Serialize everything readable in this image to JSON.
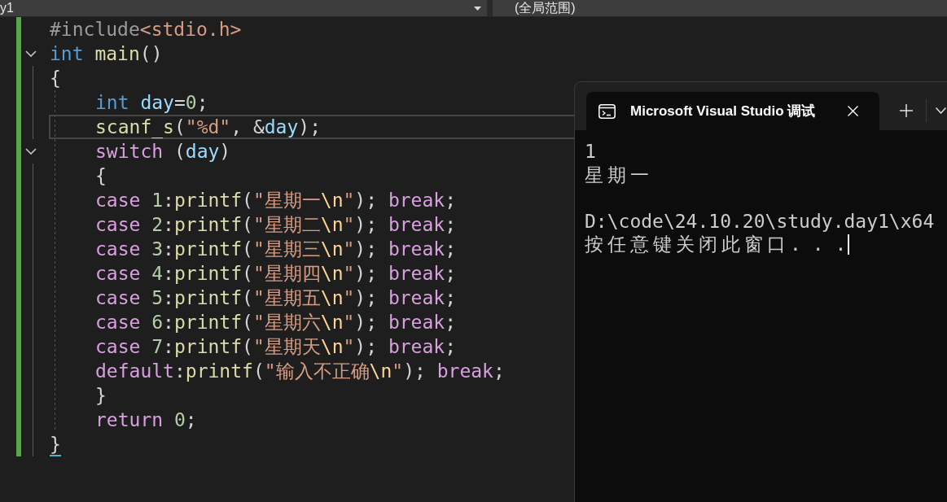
{
  "toolbar": {
    "dropdowns": [
      {
        "value": "y1",
        "caret": true
      },
      {
        "value": "(全局范围)",
        "caret": false
      }
    ]
  },
  "editor": {
    "lines": [
      {
        "tokens": [
          {
            "kind": "preprocessor",
            "text": "#include"
          },
          {
            "kind": "include",
            "text": "<stdio.h>"
          }
        ],
        "selected": false,
        "changed": true
      },
      {
        "tokens": [
          {
            "kind": "type",
            "text": "int "
          },
          {
            "kind": "function",
            "text": "main"
          },
          {
            "kind": "punct",
            "text": "()"
          }
        ],
        "selected": false,
        "changed": true,
        "expanded": true
      },
      {
        "tokens": [
          {
            "kind": "punct",
            "text": "{"
          }
        ],
        "selected": false,
        "changed": true,
        "children": [
          {
            "tokens": [
              {
                "kind": "type",
                "text": "int "
              },
              {
                "kind": "variable",
                "text": "day"
              },
              {
                "kind": "punct",
                "text": "="
              },
              {
                "kind": "number",
                "text": "0"
              },
              {
                "kind": "punct",
                "text": ";"
              }
            ],
            "selected": false,
            "changed": true
          },
          {
            "tokens": [
              {
                "kind": "function",
                "text": "scanf_s"
              },
              {
                "kind": "punct",
                "text": "("
              },
              {
                "kind": "string",
                "text": "\"%d\""
              },
              {
                "kind": "punct",
                "text": ", &"
              },
              {
                "kind": "variable",
                "text": "day"
              },
              {
                "kind": "punct",
                "text": ");"
              }
            ],
            "selected": true,
            "changed": true
          },
          {
            "tokens": [
              {
                "kind": "control",
                "text": "switch "
              },
              {
                "kind": "punct",
                "text": "("
              },
              {
                "kind": "variable",
                "text": "day"
              },
              {
                "kind": "punct",
                "text": ")"
              }
            ],
            "selected": false,
            "changed": true,
            "expanded": true
          },
          {
            "tokens": [
              {
                "kind": "punct",
                "text": "{"
              }
            ],
            "selected": false,
            "changed": true
          },
          {
            "tokens": [
              {
                "kind": "control",
                "text": "case "
              },
              {
                "kind": "number",
                "text": "1"
              },
              {
                "kind": "punct",
                "text": ":"
              },
              {
                "kind": "function",
                "text": "printf"
              },
              {
                "kind": "punct",
                "text": "("
              },
              {
                "kind": "string",
                "text": "\"星期一"
              },
              {
                "kind": "escape",
                "text": "\\n"
              },
              {
                "kind": "string",
                "text": "\""
              },
              {
                "kind": "punct",
                "text": "); "
              },
              {
                "kind": "control",
                "text": "break"
              },
              {
                "kind": "punct",
                "text": ";"
              }
            ],
            "selected": false,
            "changed": true
          },
          {
            "tokens": [
              {
                "kind": "control",
                "text": "case "
              },
              {
                "kind": "number",
                "text": "2"
              },
              {
                "kind": "punct",
                "text": ":"
              },
              {
                "kind": "function",
                "text": "printf"
              },
              {
                "kind": "punct",
                "text": "("
              },
              {
                "kind": "string",
                "text": "\"星期二"
              },
              {
                "kind": "escape",
                "text": "\\n"
              },
              {
                "kind": "string",
                "text": "\""
              },
              {
                "kind": "punct",
                "text": "); "
              },
              {
                "kind": "control",
                "text": "break"
              },
              {
                "kind": "punct",
                "text": ";"
              }
            ],
            "selected": false,
            "changed": true
          },
          {
            "tokens": [
              {
                "kind": "control",
                "text": "case "
              },
              {
                "kind": "number",
                "text": "3"
              },
              {
                "kind": "punct",
                "text": ":"
              },
              {
                "kind": "function",
                "text": "printf"
              },
              {
                "kind": "punct",
                "text": "("
              },
              {
                "kind": "string",
                "text": "\"星期三"
              },
              {
                "kind": "escape",
                "text": "\\n"
              },
              {
                "kind": "string",
                "text": "\""
              },
              {
                "kind": "punct",
                "text": "); "
              },
              {
                "kind": "control",
                "text": "break"
              },
              {
                "kind": "punct",
                "text": ";"
              }
            ],
            "selected": false,
            "changed": true
          },
          {
            "tokens": [
              {
                "kind": "control",
                "text": "case "
              },
              {
                "kind": "number",
                "text": "4"
              },
              {
                "kind": "punct",
                "text": ":"
              },
              {
                "kind": "function",
                "text": "printf"
              },
              {
                "kind": "punct",
                "text": "("
              },
              {
                "kind": "string",
                "text": "\"星期四"
              },
              {
                "kind": "escape",
                "text": "\\n"
              },
              {
                "kind": "string",
                "text": "\""
              },
              {
                "kind": "punct",
                "text": "); "
              },
              {
                "kind": "control",
                "text": "break"
              },
              {
                "kind": "punct",
                "text": ";"
              }
            ],
            "selected": false,
            "changed": true
          },
          {
            "tokens": [
              {
                "kind": "control",
                "text": "case "
              },
              {
                "kind": "number",
                "text": "5"
              },
              {
                "kind": "punct",
                "text": ":"
              },
              {
                "kind": "function",
                "text": "printf"
              },
              {
                "kind": "punct",
                "text": "("
              },
              {
                "kind": "string",
                "text": "\"星期五"
              },
              {
                "kind": "escape",
                "text": "\\n"
              },
              {
                "kind": "string",
                "text": "\""
              },
              {
                "kind": "punct",
                "text": "); "
              },
              {
                "kind": "control",
                "text": "break"
              },
              {
                "kind": "punct",
                "text": ";"
              }
            ],
            "selected": false,
            "changed": true
          },
          {
            "tokens": [
              {
                "kind": "control",
                "text": "case "
              },
              {
                "kind": "number",
                "text": "6"
              },
              {
                "kind": "punct",
                "text": ":"
              },
              {
                "kind": "function",
                "text": "printf"
              },
              {
                "kind": "punct",
                "text": "("
              },
              {
                "kind": "string",
                "text": "\"星期六"
              },
              {
                "kind": "escape",
                "text": "\\n"
              },
              {
                "kind": "string",
                "text": "\""
              },
              {
                "kind": "punct",
                "text": "); "
              },
              {
                "kind": "control",
                "text": "break"
              },
              {
                "kind": "punct",
                "text": ";"
              }
            ],
            "selected": false,
            "changed": true
          },
          {
            "tokens": [
              {
                "kind": "control",
                "text": "case "
              },
              {
                "kind": "number",
                "text": "7"
              },
              {
                "kind": "punct",
                "text": ":"
              },
              {
                "kind": "function",
                "text": "printf"
              },
              {
                "kind": "punct",
                "text": "("
              },
              {
                "kind": "string",
                "text": "\"星期天"
              },
              {
                "kind": "escape",
                "text": "\\n"
              },
              {
                "kind": "string",
                "text": "\""
              },
              {
                "kind": "punct",
                "text": "); "
              },
              {
                "kind": "control",
                "text": "break"
              },
              {
                "kind": "punct",
                "text": ";"
              }
            ],
            "selected": false,
            "changed": true
          },
          {
            "tokens": [
              {
                "kind": "control",
                "text": "default"
              },
              {
                "kind": "punct",
                "text": ":"
              },
              {
                "kind": "function",
                "text": "printf"
              },
              {
                "kind": "punct",
                "text": "("
              },
              {
                "kind": "string",
                "text": "\"输入不正确"
              },
              {
                "kind": "escape",
                "text": "\\n"
              },
              {
                "kind": "string",
                "text": "\""
              },
              {
                "kind": "punct",
                "text": "); "
              },
              {
                "kind": "control",
                "text": "break"
              },
              {
                "kind": "punct",
                "text": ";"
              }
            ],
            "selected": false,
            "changed": true
          },
          {
            "tokens": [
              {
                "kind": "punct",
                "text": "}"
              }
            ],
            "selected": false,
            "changed": true
          },
          {
            "tokens": [
              {
                "kind": "control",
                "text": "return "
              },
              {
                "kind": "number",
                "text": "0"
              },
              {
                "kind": "punct",
                "text": ";"
              }
            ],
            "selected": false,
            "changed": true
          }
        ]
      },
      {
        "tokens": [
          {
            "kind": "brace_match",
            "text": "}"
          }
        ],
        "selected": false,
        "changed": true
      }
    ]
  },
  "terminal": {
    "tabs": [
      {
        "title": "Microsoft Visual Studio 调试",
        "selected": true
      }
    ],
    "output": [
      {
        "kind": "text",
        "text": "1"
      },
      {
        "kind": "text",
        "text": "星期一"
      },
      {
        "kind": "blank"
      },
      {
        "kind": "text",
        "text": "D:\\code\\24.10.20\\study.day1\\x64"
      },
      {
        "kind": "prompt",
        "text": "按任意键关闭此窗口. . ."
      }
    ]
  }
}
